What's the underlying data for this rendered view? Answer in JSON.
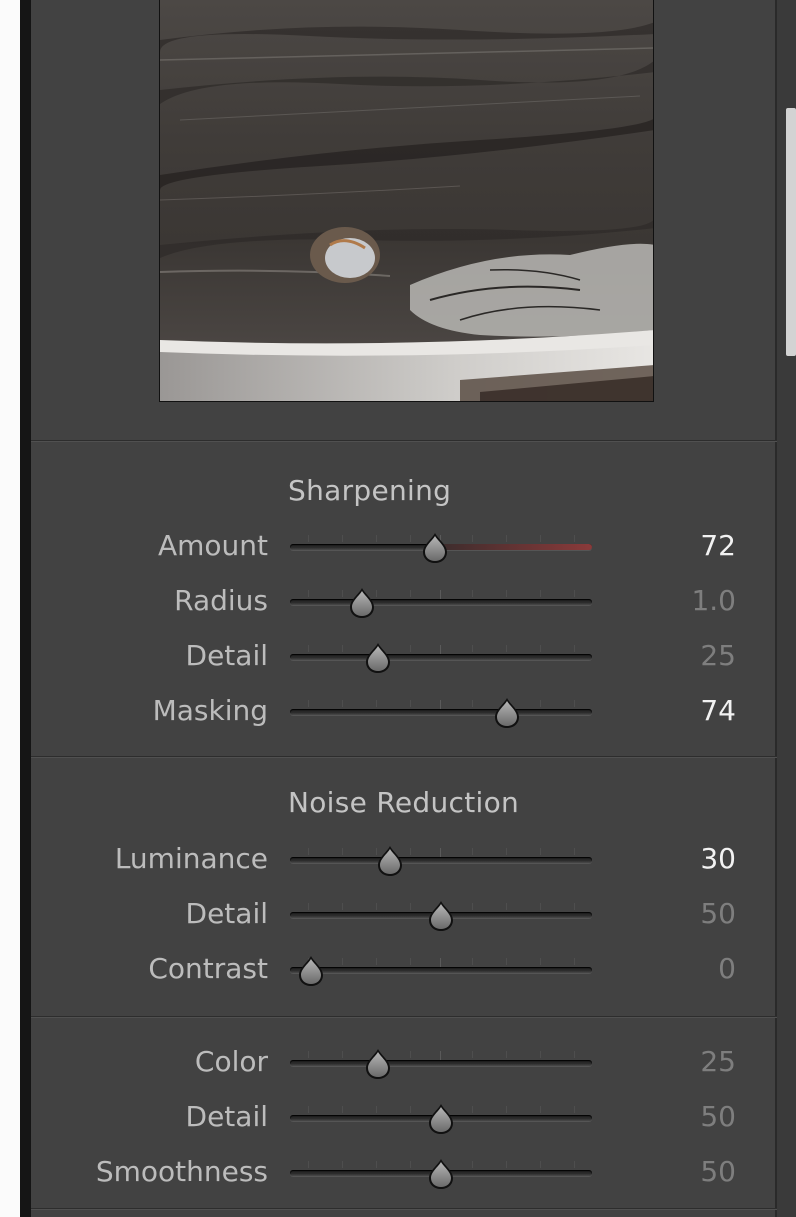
{
  "sharpening": {
    "title": "Sharpening",
    "sliders": [
      {
        "label": "Amount",
        "value": "72",
        "pos": 0.48,
        "highlight": true,
        "red_from": 0.48
      },
      {
        "label": "Radius",
        "value": "1.0",
        "pos": 0.24,
        "highlight": false
      },
      {
        "label": "Detail",
        "value": "25",
        "pos": 0.29,
        "highlight": false
      },
      {
        "label": "Masking",
        "value": "74",
        "pos": 0.72,
        "highlight": true
      }
    ]
  },
  "noise_reduction": {
    "title": "Noise Reduction",
    "luminance_sliders": [
      {
        "label": "Luminance",
        "value": "30",
        "pos": 0.33,
        "highlight": true
      },
      {
        "label": "Detail",
        "value": "50",
        "pos": 0.5,
        "highlight": false
      },
      {
        "label": "Contrast",
        "value": "0",
        "pos": 0.07,
        "highlight": false
      }
    ],
    "color_sliders": [
      {
        "label": "Color",
        "value": "25",
        "pos": 0.29,
        "highlight": false
      },
      {
        "label": "Detail",
        "value": "50",
        "pos": 0.5,
        "highlight": false
      },
      {
        "label": "Smoothness",
        "value": "50",
        "pos": 0.5,
        "highlight": false
      }
    ]
  },
  "colors": {
    "value_highlight": "#f2f2f2",
    "value_dim": "#7e7e7e",
    "amount_track_red": "#8a3a3a"
  }
}
